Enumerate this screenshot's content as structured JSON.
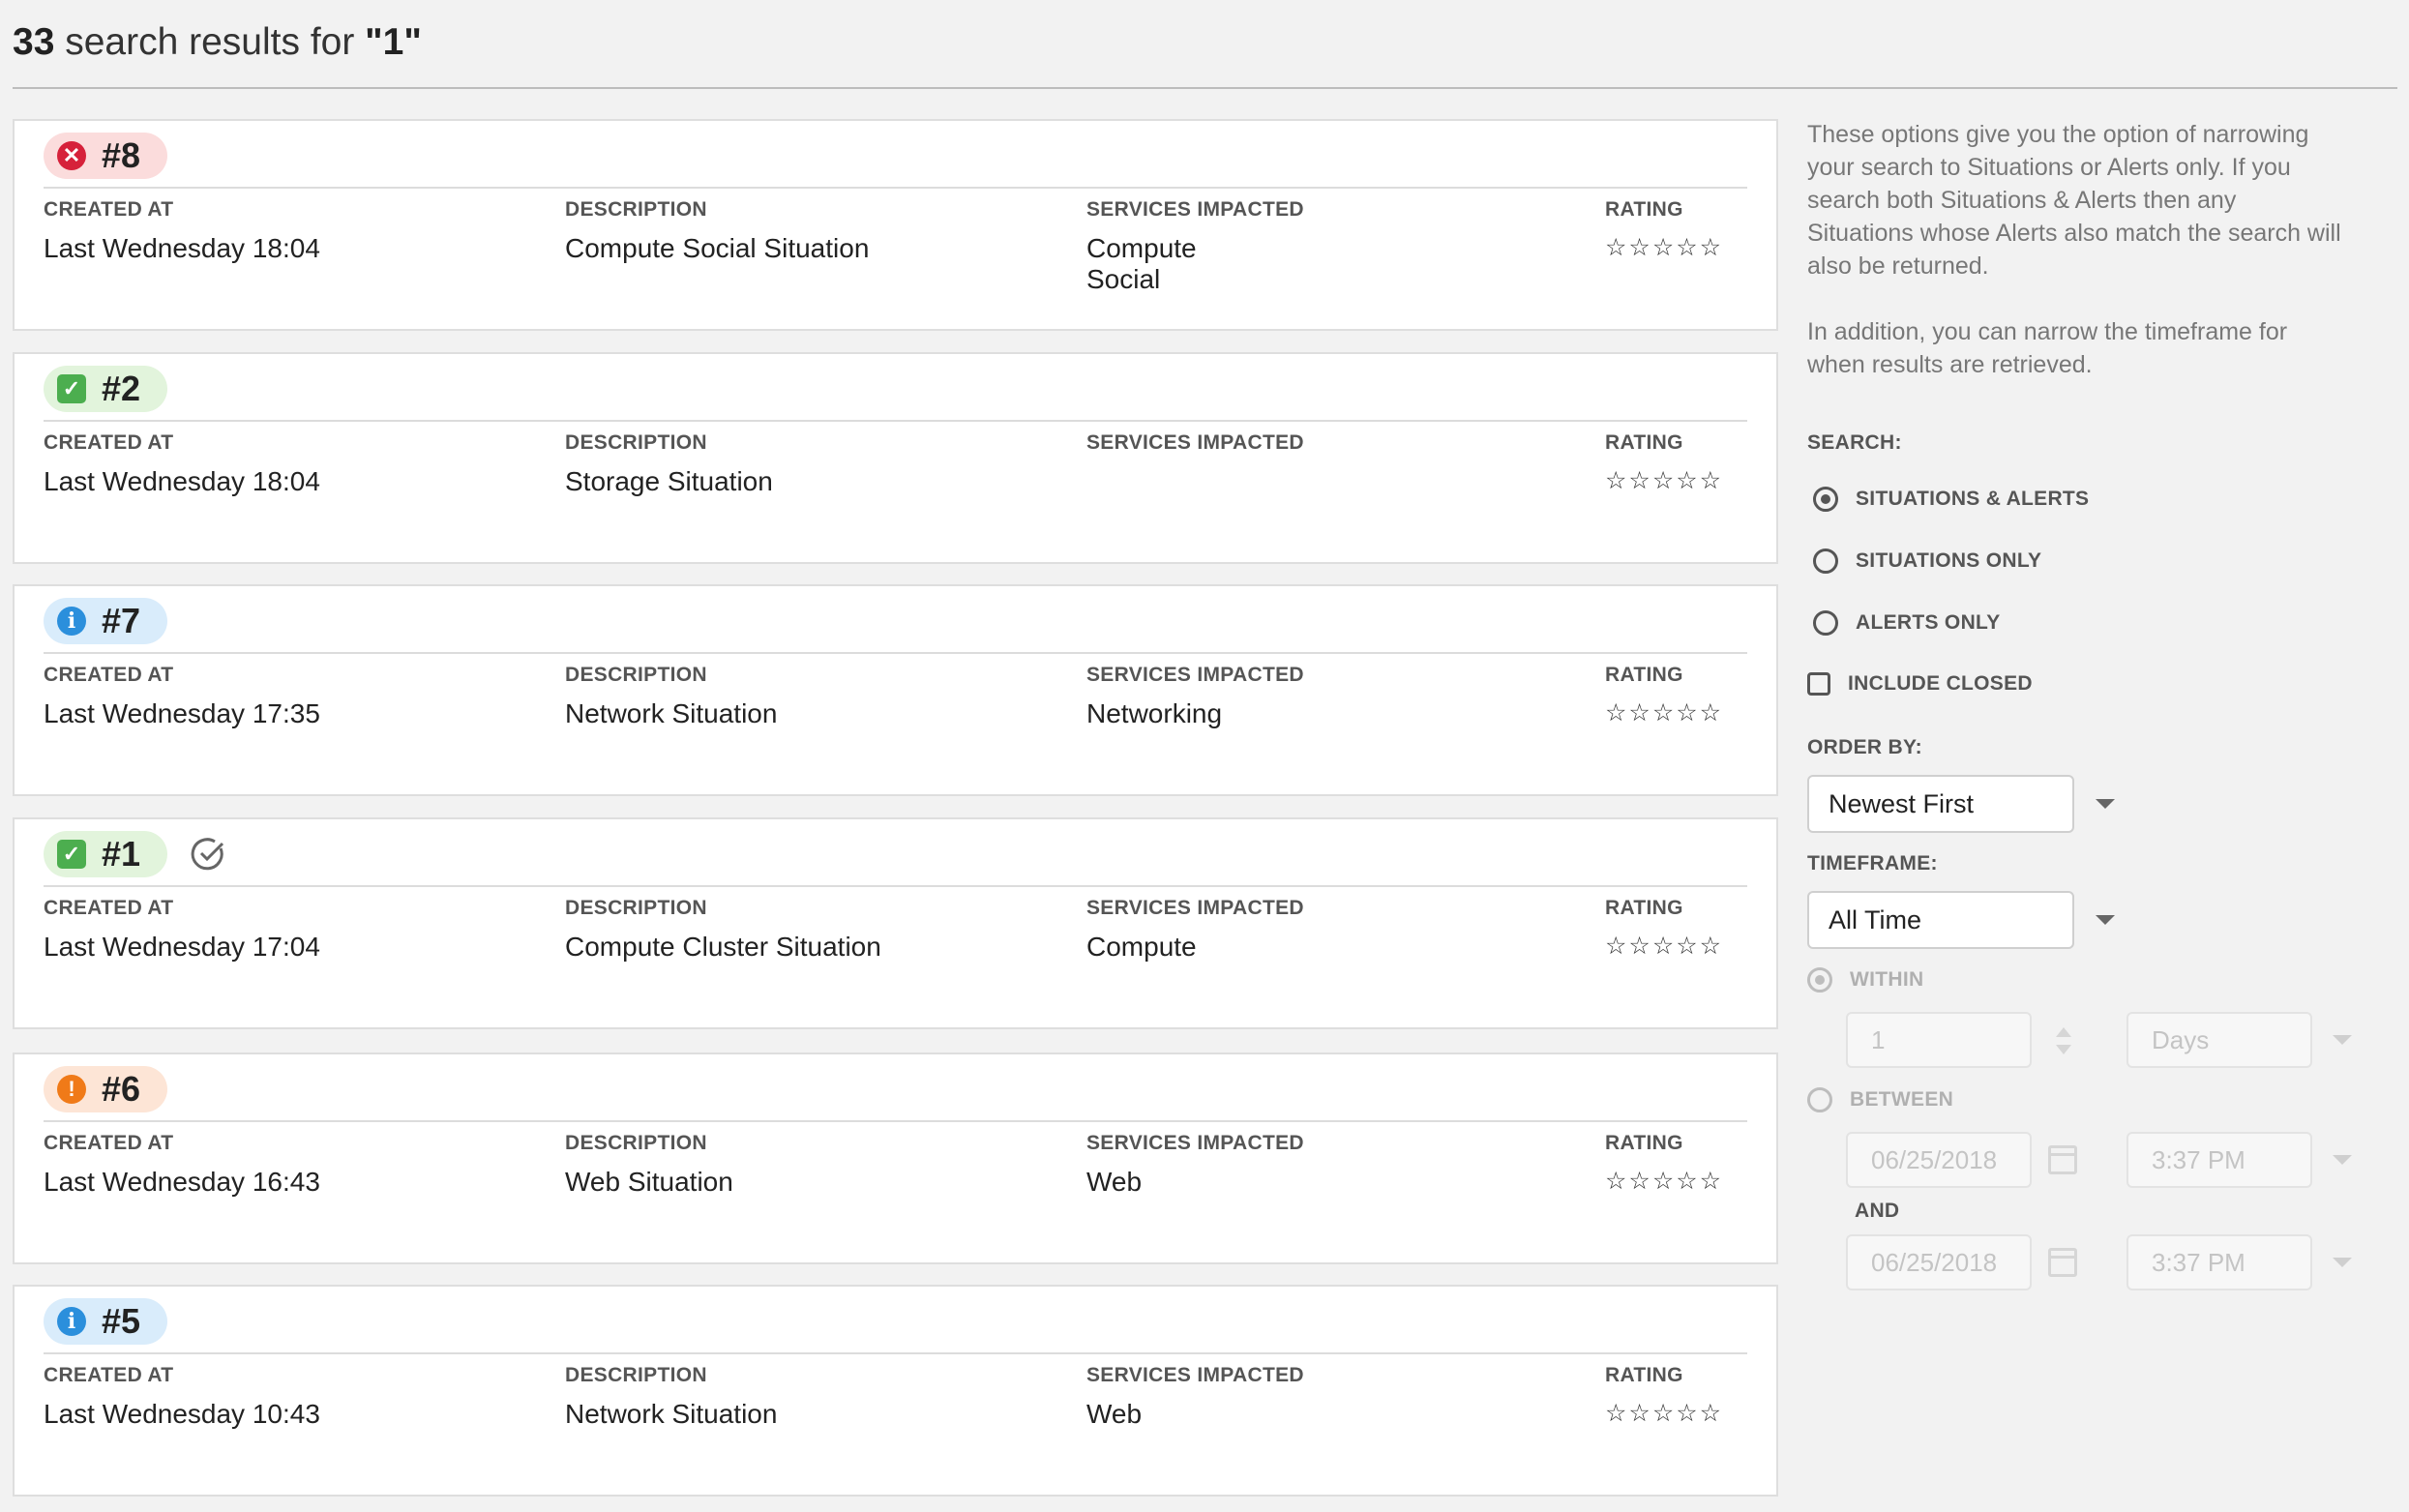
{
  "header": {
    "count": "33",
    "middle": " search results for ",
    "query": "\"1\""
  },
  "columns": {
    "created": "CREATED AT",
    "description": "DESCRIPTION",
    "services": "SERVICES IMPACTED",
    "rating": "RATING"
  },
  "results": [
    {
      "id": "#8",
      "status": "red",
      "status_icon": "x-circle-icon",
      "created": "Last Wednesday 18:04",
      "description": "Compute Social Situation",
      "services": [
        "Compute",
        "Social"
      ],
      "rating": "☆☆☆☆☆",
      "acknowledged": false
    },
    {
      "id": "#2",
      "status": "green",
      "status_icon": "check-square-icon",
      "created": "Last Wednesday 18:04",
      "description": "Storage Situation",
      "services": [],
      "rating": "☆☆☆☆☆",
      "acknowledged": false
    },
    {
      "id": "#7",
      "status": "blue",
      "status_icon": "info-icon",
      "created": "Last Wednesday 17:35",
      "description": "Network Situation",
      "services": [
        "Networking"
      ],
      "rating": "☆☆☆☆☆",
      "acknowledged": false
    },
    {
      "id": "#1",
      "status": "green",
      "status_icon": "check-square-icon",
      "created": "Last Wednesday 17:04",
      "description": "Compute Cluster Situation",
      "services": [
        "Compute"
      ],
      "rating": "☆☆☆☆☆",
      "acknowledged": true
    },
    {
      "id": "#6",
      "status": "orange",
      "status_icon": "exclamation-icon",
      "created": "Last Wednesday 16:43",
      "description": "Web Situation",
      "services": [
        "Web"
      ],
      "rating": "☆☆☆☆☆",
      "acknowledged": false
    },
    {
      "id": "#5",
      "status": "blue",
      "status_icon": "info-icon",
      "created": "Last Wednesday 10:43",
      "description": "Network Situation",
      "services": [
        "Web"
      ],
      "rating": "☆☆☆☆☆",
      "acknowledged": false
    }
  ],
  "sidebar": {
    "help1": "These options give you the option of narrowing your search to Situations or Alerts only. If you search both Situations & Alerts then any Situations whose Alerts also match the search will also be returned.",
    "help2": "In addition, you can narrow the timeframe for when results are retrieved.",
    "search_label": "SEARCH:",
    "opt_both": "SITUATIONS & ALERTS",
    "opt_situations": "SITUATIONS ONLY",
    "opt_alerts": "ALERTS ONLY",
    "include_closed": "INCLUDE CLOSED",
    "order_label": "ORDER BY:",
    "order_value": "Newest First",
    "timeframe_label": "TIMEFRAME:",
    "timeframe_value": "All Time",
    "within": "WITHIN",
    "within_value": "1",
    "within_unit": "Days",
    "between": "BETWEEN",
    "from_date": "06/25/2018",
    "from_time": "3:37 PM",
    "and": "AND",
    "to_date": "06/25/2018",
    "to_time": "3:37 PM"
  }
}
